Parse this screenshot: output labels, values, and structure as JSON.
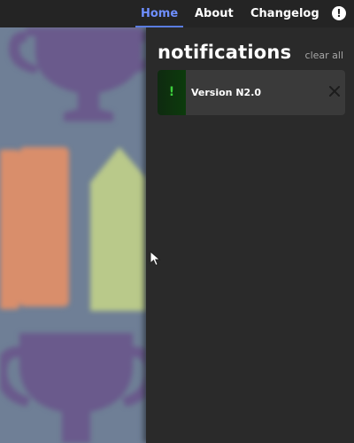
{
  "nav": {
    "tabs": [
      {
        "label": "Home",
        "active": true
      },
      {
        "label": "About",
        "active": false
      },
      {
        "label": "Changelog",
        "active": false
      }
    ],
    "alert_icon": "exclamation-circle-icon",
    "alert_symbol": "!"
  },
  "notifications": {
    "title": "notifications",
    "clear_all_label": "clear all",
    "items": [
      {
        "text": "Version N2.0",
        "icon_symbol": "!",
        "accent_color": "#3cd03c",
        "close_icon": "close-icon"
      }
    ]
  },
  "colors": {
    "nav_active": "#6f8fff",
    "panel_bg": "#2a2a2a",
    "topbar_bg": "#242424",
    "notif_bg": "#3a3a3a",
    "backdrop_bg": "#6f7f96",
    "trophy": "#6a5a8c",
    "letter_orange": "#d98e6b",
    "letter_green": "#b9c98a"
  }
}
